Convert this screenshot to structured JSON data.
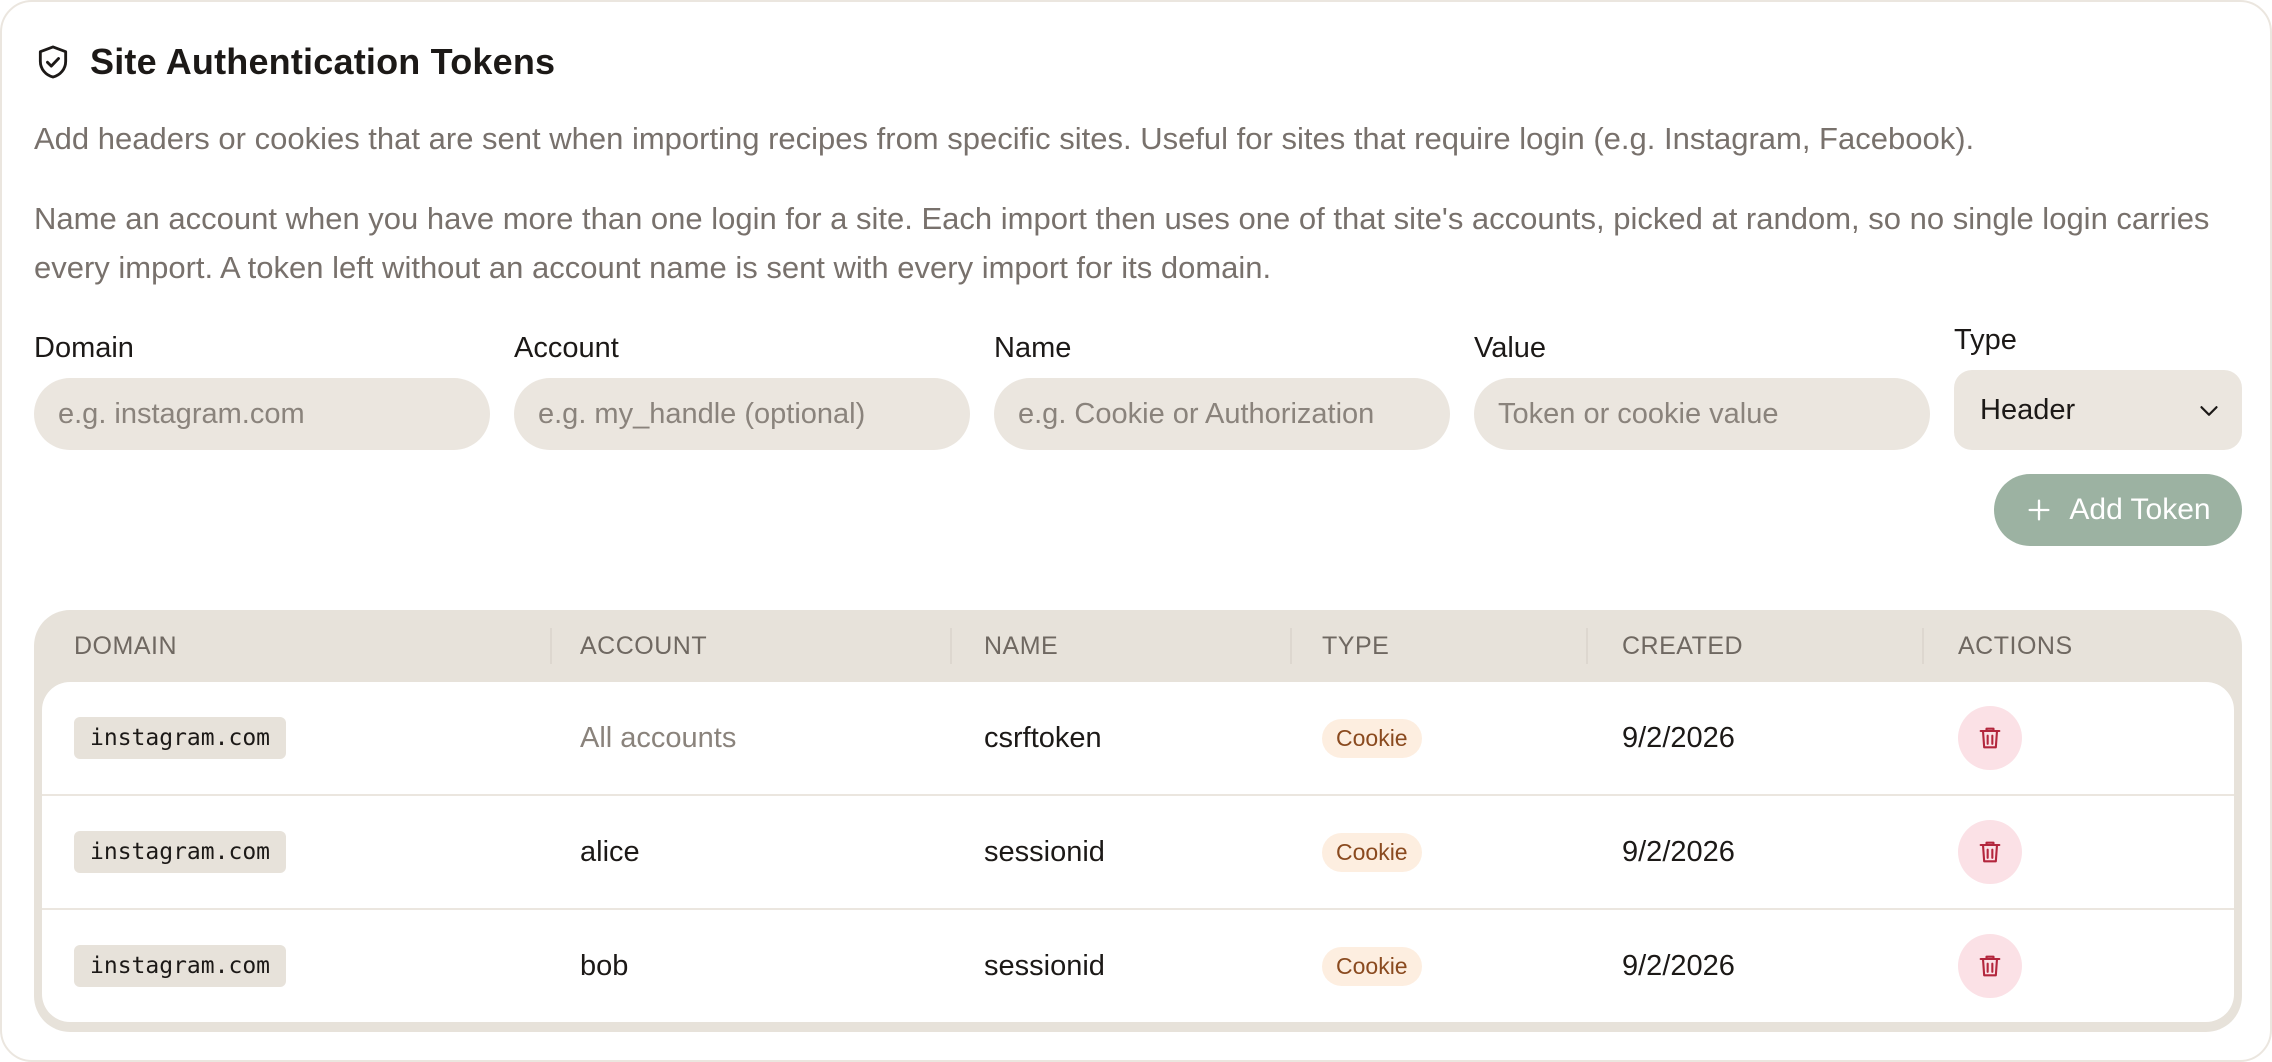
{
  "section": {
    "title": "Site Authentication Tokens",
    "icon": "shield-check-icon",
    "description_1": "Add headers or cookies that are sent when importing recipes from specific sites. Useful for sites that require login (e.g. Instagram, Facebook).",
    "description_2": "Name an account when you have more than one login for a site. Each import then uses one of that site's accounts, picked at random, so no single login carries every import. A token left without an account name is sent with every import for its domain."
  },
  "form": {
    "domain": {
      "label": "Domain",
      "placeholder": "e.g. instagram.com",
      "value": ""
    },
    "account": {
      "label": "Account",
      "placeholder": "e.g. my_handle (optional)",
      "value": ""
    },
    "name": {
      "label": "Name",
      "placeholder": "e.g. Cookie or Authorization",
      "value": ""
    },
    "value": {
      "label": "Value",
      "placeholder": "Token or cookie value",
      "value": ""
    },
    "type": {
      "label": "Type",
      "selected": "Header"
    },
    "add_button": {
      "label": "Add Token",
      "icon": "plus-icon"
    }
  },
  "table": {
    "headers": [
      "DOMAIN",
      "ACCOUNT",
      "NAME",
      "TYPE",
      "CREATED",
      "ACTIONS"
    ],
    "rows": [
      {
        "domain": "instagram.com",
        "account": "All accounts",
        "account_muted": true,
        "name": "csrftoken",
        "type": "Cookie",
        "created": "9/2/2026"
      },
      {
        "domain": "instagram.com",
        "account": "alice",
        "account_muted": false,
        "name": "sessionid",
        "type": "Cookie",
        "created": "9/2/2026"
      },
      {
        "domain": "instagram.com",
        "account": "bob",
        "account_muted": false,
        "name": "sessionid",
        "type": "Cookie",
        "created": "9/2/2026"
      }
    ],
    "delete_icon": "trash-icon"
  },
  "colors": {
    "accent_button": "#9cb2a2",
    "input_bg": "#ebe6df",
    "badge_bg": "#fdeee0",
    "badge_text": "#8a4a1f",
    "delete_bg": "#fbe1e6",
    "delete_icon": "#b3263d"
  }
}
